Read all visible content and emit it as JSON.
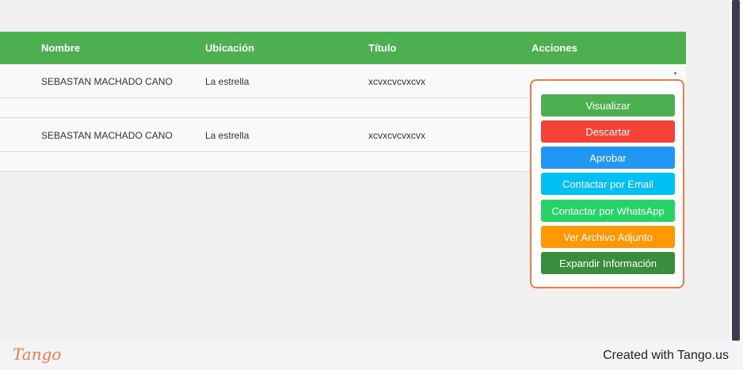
{
  "table": {
    "headers": [
      "Nombre",
      "Ubicación",
      "Título",
      "Acciones"
    ],
    "rows": [
      {
        "nombre": "SEBASTAN MACHADO CANO",
        "ubicacion": "La estrella",
        "titulo": "xcvxcvcvxcvx"
      },
      {
        "nombre": "SEBASTAN MACHADO CANO",
        "ubicacion": "La estrella",
        "titulo": "xcvxcvcvxcvx"
      }
    ]
  },
  "actions_menu": {
    "items": [
      {
        "label": "Visualizar",
        "color": "#4caf50"
      },
      {
        "label": "Descartar",
        "color": "#f44336"
      },
      {
        "label": "Aprobar",
        "color": "#2196f3"
      },
      {
        "label": "Contactar por Email",
        "color": "#03c0f3"
      },
      {
        "label": "Contactar por WhatsApp",
        "color": "#25d366"
      },
      {
        "label": "Ver Archivo Adjunto",
        "color": "#ff9800"
      },
      {
        "label": "Expandir Información",
        "color": "#388e3c"
      }
    ]
  },
  "footer": {
    "logo": "Tango",
    "credit": "Created with Tango.us"
  },
  "colors": {
    "header_green": "#4caf50",
    "highlight": "#f07a4a"
  }
}
